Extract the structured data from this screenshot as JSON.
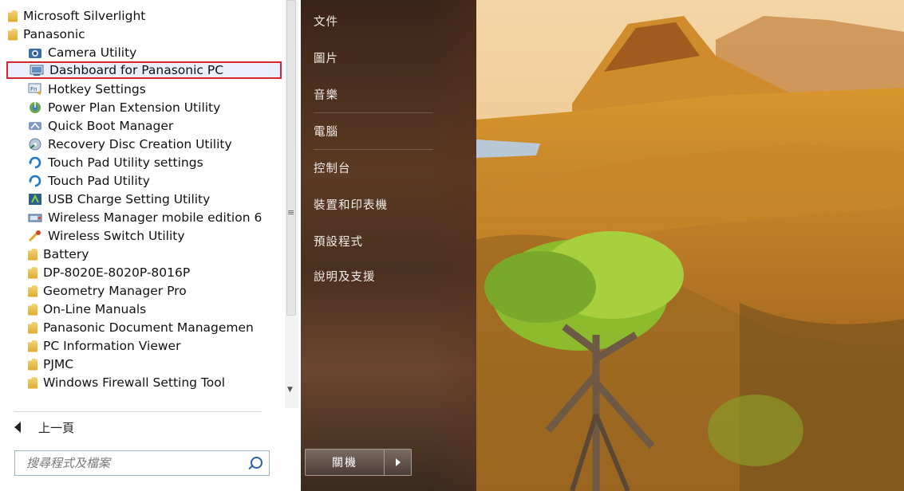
{
  "programs": [
    {
      "label": "Microsoft Silverlight",
      "icon": "folder-icon",
      "level": 0
    },
    {
      "label": "Panasonic",
      "icon": "folder-icon",
      "level": 0
    },
    {
      "label": "Camera Utility",
      "icon": "camera-icon",
      "level": 1
    },
    {
      "label": "Dashboard for Panasonic PC",
      "icon": "dashboard-icon",
      "level": 1,
      "selected": true
    },
    {
      "label": "Hotkey Settings",
      "icon": "hotkey-icon",
      "level": 1
    },
    {
      "label": "Power Plan Extension Utility",
      "icon": "power-plan-icon",
      "level": 1
    },
    {
      "label": "Quick Boot Manager",
      "icon": "quick-boot-icon",
      "level": 1
    },
    {
      "label": "Recovery Disc Creation Utility",
      "icon": "recovery-disc-icon",
      "level": 1
    },
    {
      "label": "Touch Pad Utility settings",
      "icon": "touchpad-icon",
      "level": 1
    },
    {
      "label": "Touch Pad Utility",
      "icon": "touchpad-icon",
      "level": 1
    },
    {
      "label": "USB Charge Setting Utility",
      "icon": "usb-charge-icon",
      "level": 1
    },
    {
      "label": "Wireless Manager mobile edition 6",
      "icon": "wireless-manager-icon",
      "level": 1
    },
    {
      "label": "Wireless Switch Utility",
      "icon": "wireless-switch-icon",
      "level": 1
    },
    {
      "label": "Battery",
      "icon": "folder-icon",
      "level": 1
    },
    {
      "label": "DP-8020E-8020P-8016P",
      "icon": "folder-icon",
      "level": 1
    },
    {
      "label": "Geometry Manager Pro",
      "icon": "folder-icon",
      "level": 1
    },
    {
      "label": "On-Line Manuals",
      "icon": "folder-icon",
      "level": 1
    },
    {
      "label": "Panasonic Document Managemen",
      "icon": "folder-icon",
      "level": 1
    },
    {
      "label": "PC Information Viewer",
      "icon": "folder-icon",
      "level": 1
    },
    {
      "label": "PJMC",
      "icon": "folder-icon",
      "level": 1
    },
    {
      "label": "Windows Firewall Setting Tool",
      "icon": "folder-icon",
      "level": 1
    }
  ],
  "back_label": "上一頁",
  "search": {
    "placeholder": "搜尋程式及檔案"
  },
  "right_menu": [
    "文件",
    "圖片",
    "音樂",
    "電腦",
    "控制台",
    "裝置和印表機",
    "預設程式",
    "說明及支援"
  ],
  "shutdown_label": "關機",
  "colors": {
    "selection_border": "#d8242c",
    "right_panel": "#4a3020",
    "search_icon": "#2a5fa8"
  }
}
